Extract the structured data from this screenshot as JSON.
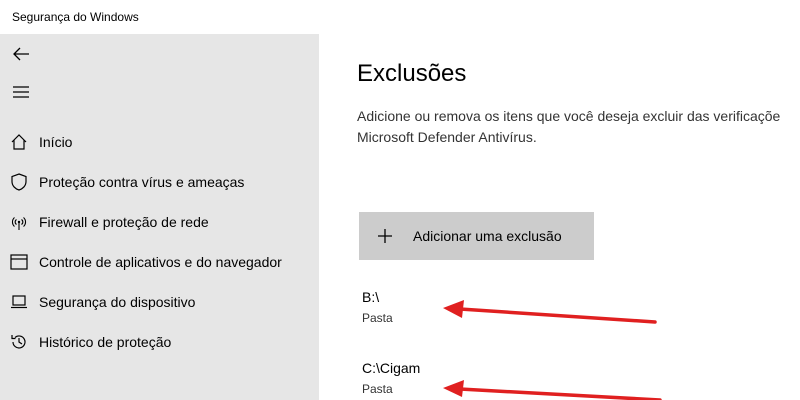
{
  "window": {
    "title": "Segurança do Windows"
  },
  "sidebar": {
    "back_icon": "back-arrow-icon",
    "menu_icon": "hamburger-menu-icon",
    "items": [
      {
        "icon": "home-icon",
        "label": "Início"
      },
      {
        "icon": "shield-icon",
        "label": "Proteção contra vírus e ameaças"
      },
      {
        "icon": "wireless-icon",
        "label": "Firewall e proteção de rede"
      },
      {
        "icon": "app-browser-icon",
        "label": "Controle de aplicativos e do navegador"
      },
      {
        "icon": "laptop-icon",
        "label": "Segurança do dispositivo"
      },
      {
        "icon": "history-icon",
        "label": "Histórico de proteção"
      }
    ]
  },
  "main": {
    "title": "Exclusões",
    "description_line1": "Adicione ou remova os itens que você deseja excluir das verificaçõe",
    "description_line2": "Microsoft Defender Antivírus.",
    "add_button_label": "Adicionar uma exclusão",
    "exclusions": [
      {
        "path": "B:\\",
        "type": "Pasta"
      },
      {
        "path": "C:\\Cigam",
        "type": "Pasta"
      }
    ]
  },
  "annotation": {
    "arrow_color": "#e02020"
  }
}
